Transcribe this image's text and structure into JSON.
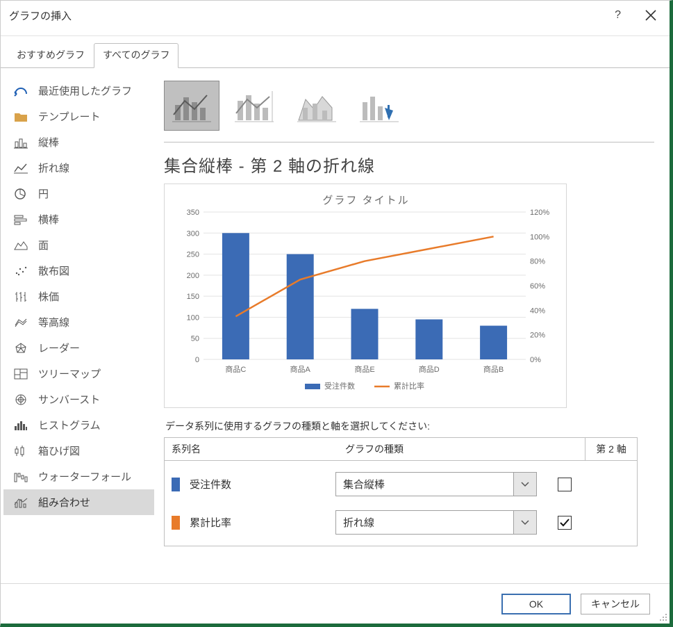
{
  "window": {
    "title": "グラフの挿入",
    "help_label": "?",
    "close_label": "×"
  },
  "tabs": {
    "recommended": "おすすめグラフ",
    "all": "すべてのグラフ"
  },
  "sidebar": {
    "items": [
      {
        "label": "最近使用したグラフ",
        "icon": "recent"
      },
      {
        "label": "テンプレート",
        "icon": "template"
      },
      {
        "label": "縦棒",
        "icon": "column"
      },
      {
        "label": "折れ線",
        "icon": "line"
      },
      {
        "label": "円",
        "icon": "pie"
      },
      {
        "label": "横棒",
        "icon": "bar"
      },
      {
        "label": "面",
        "icon": "area"
      },
      {
        "label": "散布図",
        "icon": "scatter"
      },
      {
        "label": "株価",
        "icon": "stock"
      },
      {
        "label": "等高線",
        "icon": "surface"
      },
      {
        "label": "レーダー",
        "icon": "radar"
      },
      {
        "label": "ツリーマップ",
        "icon": "treemap"
      },
      {
        "label": "サンバースト",
        "icon": "sunburst"
      },
      {
        "label": "ヒストグラム",
        "icon": "histogram"
      },
      {
        "label": "箱ひげ図",
        "icon": "boxwhisker"
      },
      {
        "label": "ウォーターフォール",
        "icon": "waterfall"
      },
      {
        "label": "組み合わせ",
        "icon": "combo"
      }
    ],
    "selected_index": 16
  },
  "subtype": {
    "selected_index": 0,
    "title": "集合縦棒 - 第 2 軸の折れ線"
  },
  "series_section": {
    "caption": "データ系列に使用するグラフの種類と軸を選択してください:",
    "col_name": "系列名",
    "col_type": "グラフの種類",
    "col_axis": "第 2 軸",
    "rows": [
      {
        "name": "受注件数",
        "type": "集合縦棒",
        "axis2": false,
        "color": "#3b6bb5"
      },
      {
        "name": "累計比率",
        "type": "折れ線",
        "axis2": true,
        "color": "#e87b2a"
      }
    ]
  },
  "buttons": {
    "ok": "OK",
    "cancel": "キャンセル"
  },
  "chart_data": {
    "type": "combo",
    "title": "グラフ タイトル",
    "categories": [
      "商品C",
      "商品A",
      "商品E",
      "商品D",
      "商品B"
    ],
    "series": [
      {
        "name": "受注件数",
        "type": "bar",
        "axis": "left",
        "color": "#3b6bb5",
        "values": [
          300,
          250,
          120,
          95,
          80
        ]
      },
      {
        "name": "累計比率",
        "type": "line",
        "axis": "right",
        "color": "#e87b2a",
        "values": [
          35,
          65,
          80,
          90,
          100
        ],
        "unit": "%"
      }
    ],
    "y_left": {
      "min": 0,
      "max": 350,
      "step": 50,
      "label": ""
    },
    "y_right": {
      "min": 0,
      "max": 120,
      "step": 20,
      "unit": "%",
      "label": ""
    },
    "legend_position": "bottom"
  }
}
